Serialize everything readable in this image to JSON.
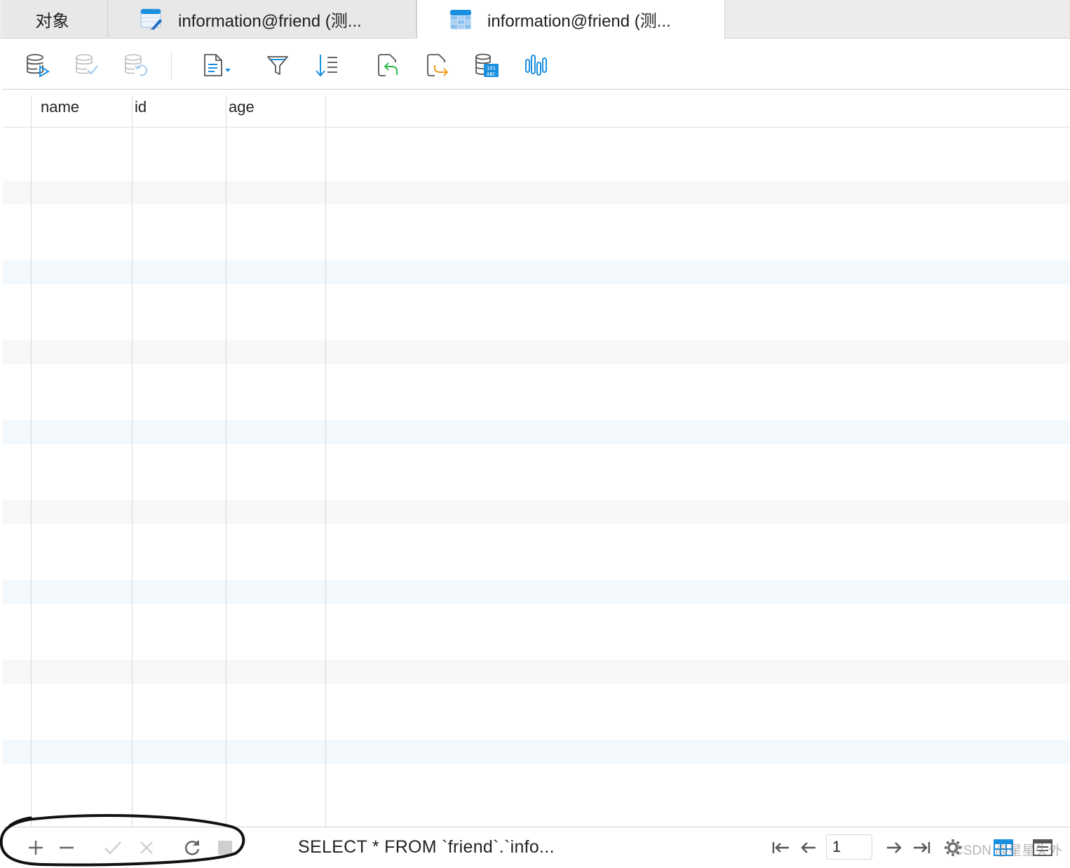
{
  "tabs": [
    {
      "label": "对象",
      "icon": "object-list-icon",
      "active": false
    },
    {
      "label": "information@friend (测...",
      "icon": "table-design-icon",
      "active": false
    },
    {
      "label": "information@friend (测...",
      "icon": "table-data-icon",
      "active": true
    }
  ],
  "toolbar": {
    "buttons": [
      {
        "name": "begin-transaction-icon",
        "enabled": true
      },
      {
        "name": "commit-icon",
        "enabled": false
      },
      {
        "name": "rollback-icon",
        "enabled": false
      },
      {
        "name": "text-view-icon",
        "enabled": true
      },
      {
        "name": "filter-icon",
        "enabled": true
      },
      {
        "name": "sort-icon",
        "enabled": true
      },
      {
        "name": "import-icon",
        "enabled": true
      },
      {
        "name": "export-icon",
        "enabled": true
      },
      {
        "name": "data-generation-icon",
        "enabled": true
      },
      {
        "name": "profile-icon",
        "enabled": true
      }
    ]
  },
  "grid": {
    "columns": [
      "name",
      "id",
      "age"
    ],
    "rows": []
  },
  "status": {
    "sql": "SELECT * FROM `friend`.`info...",
    "page": "1",
    "watermark": "CSDN @星星失外"
  },
  "colors": {
    "accent": "#1a8fe0",
    "import_green": "#2fb84a",
    "export_orange": "#f39c1e",
    "stripe": "#f7f7f7",
    "stripe_blue": "#f3f8fd"
  }
}
